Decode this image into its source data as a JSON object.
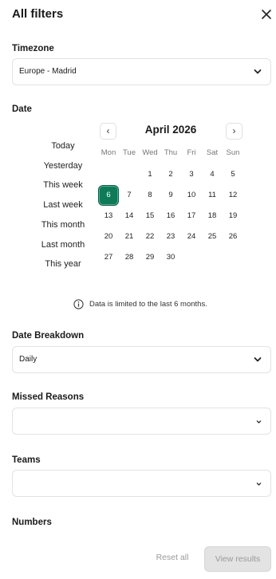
{
  "header": {
    "title": "All filters"
  },
  "timezone": {
    "label": "Timezone",
    "value": "Europe - Madrid"
  },
  "date": {
    "label": "Date",
    "quick_ranges": [
      "Today",
      "Yesterday",
      "This week",
      "Last week",
      "This month",
      "Last month",
      "This year"
    ],
    "calendar": {
      "month_label": "April 2026",
      "prev_label": "‹",
      "next_label": "›",
      "weekdays": [
        "Mon",
        "Tue",
        "Wed",
        "Thu",
        "Fri",
        "Sat",
        "Sun"
      ],
      "weeks": [
        [
          "",
          "",
          "1",
          "2",
          "3",
          "4",
          "5"
        ],
        [
          "6",
          "7",
          "8",
          "9",
          "10",
          "11",
          "12"
        ],
        [
          "13",
          "14",
          "15",
          "16",
          "17",
          "18",
          "19"
        ],
        [
          "20",
          "21",
          "22",
          "23",
          "24",
          "25",
          "26"
        ],
        [
          "27",
          "28",
          "29",
          "30",
          "",
          "",
          ""
        ]
      ],
      "selected_day": "6",
      "selected_color": "#0f7a58"
    },
    "info_text": "Data is limited to the last 6 months."
  },
  "date_breakdown": {
    "label": "Date Breakdown",
    "value": "Daily"
  },
  "missed_reasons": {
    "label": "Missed Reasons",
    "value": ""
  },
  "teams": {
    "label": "Teams",
    "value": ""
  },
  "numbers": {
    "label": "Numbers"
  },
  "footer": {
    "reset_label": "Reset all",
    "view_label": "View results"
  }
}
